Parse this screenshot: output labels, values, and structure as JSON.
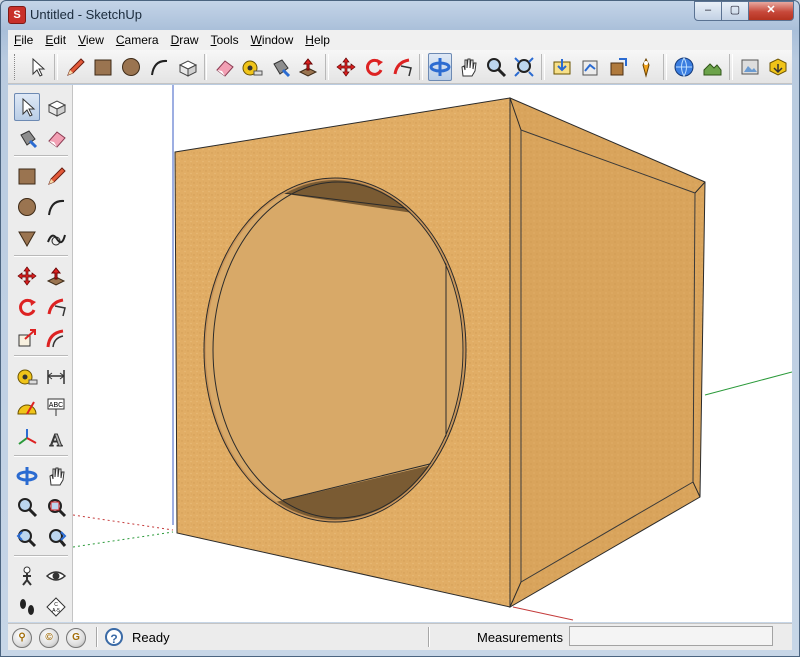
{
  "window": {
    "title": "Untitled - SketchUp",
    "app_icon_glyph": "S",
    "controls": {
      "minimize": "–",
      "maximize": "▢",
      "close": "✕"
    }
  },
  "menubar": {
    "items": [
      {
        "label": "File"
      },
      {
        "label": "Edit"
      },
      {
        "label": "View"
      },
      {
        "label": "Camera"
      },
      {
        "label": "Draw"
      },
      {
        "label": "Tools"
      },
      {
        "label": "Window"
      },
      {
        "label": "Help"
      }
    ]
  },
  "toolbar": {
    "tools": [
      "select-icon",
      "line-pencil-icon",
      "rectangle-icon",
      "circle-icon",
      "arc-icon",
      "make-component-icon",
      "eraser-icon",
      "tape-measure-icon",
      "paint-bucket-icon",
      "push-pull-icon",
      "move-icon",
      "rotate-icon",
      "follow-me-icon",
      "orbit-icon",
      "pan-icon",
      "zoom-icon",
      "zoom-extents-icon",
      "get-models-icon",
      "share-model-icon",
      "share-component-icon",
      "place-model-icon",
      "get-current-view-icon",
      "toggle-terrain-icon",
      "photo-textures-icon",
      "preview-model-icon"
    ]
  },
  "large_tool_set": {
    "rows": [
      [
        "select-icon",
        "make-component-icon"
      ],
      [
        "paint-bucket-icon",
        "eraser-icon"
      ],
      [
        "rectangle-icon",
        "line-pencil-icon"
      ],
      [
        "circle-icon",
        "arc-icon"
      ],
      [
        "polygon-icon",
        "freehand-icon"
      ],
      [
        "move-icon",
        "push-pull-icon"
      ],
      [
        "rotate-icon",
        "follow-me-icon"
      ],
      [
        "scale-icon",
        "offset-icon"
      ],
      [
        "tape-measure-icon",
        "dimension-icon"
      ],
      [
        "protractor-icon",
        "text-icon"
      ],
      [
        "axes-icon",
        "3d-text-icon"
      ],
      [
        "orbit-icon",
        "pan-icon"
      ],
      [
        "zoom-icon",
        "zoom-window-icon"
      ],
      [
        "previous-view-icon",
        "next-view-icon"
      ],
      [
        "position-camera-icon",
        "look-around-icon"
      ],
      [
        "walk-icon",
        "section-plane-icon"
      ]
    ],
    "text_glyphs": {
      "text-icon": "ABC",
      "section-plane-icon": "C\nA-5"
    }
  },
  "colors": {
    "box_front": "#e1ad65",
    "box_side": "#d9a45c",
    "box_edge": "#2b2b2b",
    "hole_interior": "#d8a968",
    "hole_shadow": "#7a5b33",
    "axis_green": "#2b9a3a",
    "axis_red": "#c43b3b",
    "axis_blue": "#3b5cc4",
    "title_text": "#1b2b3c"
  },
  "statusbar": {
    "icons": [
      "geo-location-icon",
      "credits-icon",
      "sign-in-icon"
    ],
    "help_glyph": "?",
    "status_text": "Ready",
    "measurements_label": "Measurements",
    "measurements_value": ""
  }
}
